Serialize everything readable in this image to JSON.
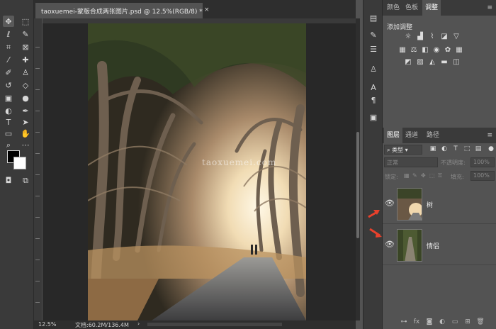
{
  "document": {
    "tab_title": "taoxuemei-蒙版合成两张图片.psd @ 12.5%(RGB/8) *",
    "close_symbol": "×",
    "watermark": "taoxuemei.com"
  },
  "status": {
    "zoom": "12.5%",
    "doc_size": "文档:60.2M/136.4M",
    "arrow": "›"
  },
  "toolbar": {
    "tools": [
      "move",
      "marquee",
      "lasso",
      "quick-select",
      "crop",
      "frame",
      "eyedropper",
      "healing",
      "brush",
      "stamp",
      "history-brush",
      "eraser",
      "gradient",
      "blur",
      "dodge",
      "pen",
      "type",
      "path-select",
      "rectangle",
      "hand",
      "zoom",
      "more",
      "quick-mask",
      "screen-mode"
    ]
  },
  "adjustments_panel": {
    "tabs": [
      "颜色",
      "色板",
      "调整"
    ],
    "active_tab": "调整",
    "title": "添加调整"
  },
  "layers_panel": {
    "tabs": [
      "图层",
      "通道",
      "路径"
    ],
    "active_tab": "图层",
    "filter_kind": "类型",
    "blend_mode": "正常",
    "opacity_label": "不透明度:",
    "opacity_value": "100%",
    "lock_label": "锁定:",
    "fill_label": "填充:",
    "fill_value": "100%",
    "layers": [
      {
        "name": "树",
        "visible": true
      },
      {
        "name": "情侣",
        "visible": true
      }
    ]
  },
  "colors": {
    "accent_arrow": "#e8412c",
    "panel_bg": "#535353",
    "dark_bg": "#282828"
  }
}
